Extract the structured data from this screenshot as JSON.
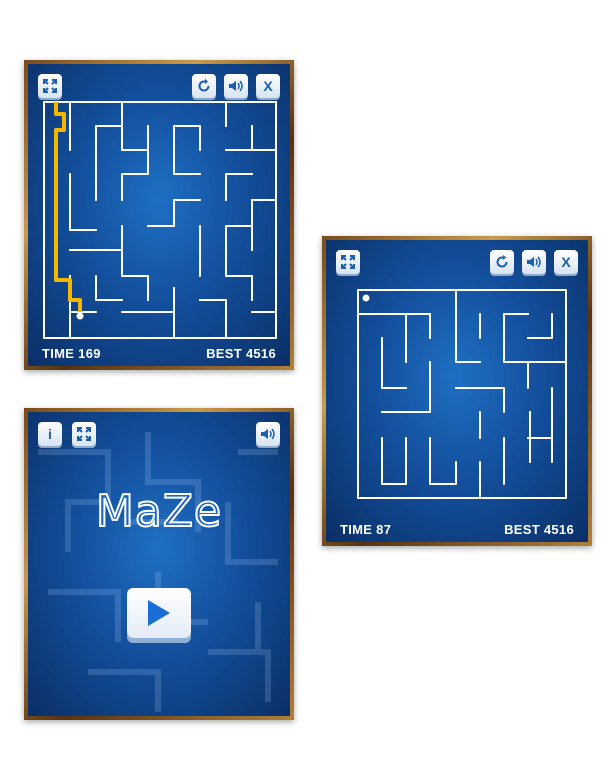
{
  "colors": {
    "accent": "#1a5fb0",
    "path": "#f5b800",
    "walls": "#ffffff",
    "frame": "#a8722e"
  },
  "screen1": {
    "icons": [
      "fullscreen-icon",
      "restart-icon",
      "sound-icon",
      "close-icon"
    ],
    "close_label": "X",
    "time": "TIME 169",
    "best": "BEST 4516"
  },
  "screen2": {
    "icons": [
      "fullscreen-icon",
      "restart-icon",
      "sound-icon",
      "close-icon"
    ],
    "close_label": "X",
    "time": "TIME 87",
    "best": "BEST 4516"
  },
  "screen3": {
    "icons": [
      "info-icon",
      "fullscreen-icon",
      "sound-icon",
      "play-icon"
    ],
    "info_label": "i",
    "title": "MaZe"
  }
}
